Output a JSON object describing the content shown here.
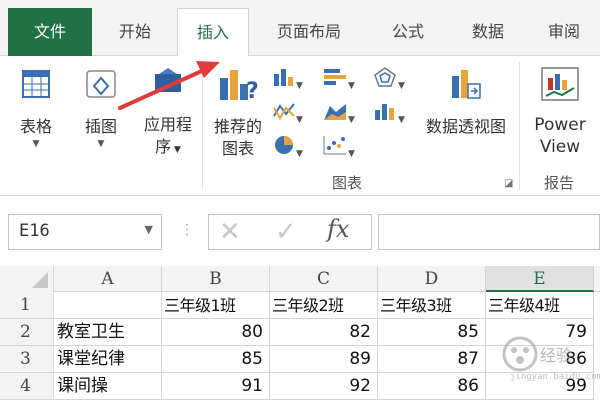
{
  "tabs": [
    {
      "label": "文件"
    },
    {
      "label": "开始"
    },
    {
      "label": "插入"
    },
    {
      "label": "页面布局"
    },
    {
      "label": "公式"
    },
    {
      "label": "数据"
    },
    {
      "label": "审阅"
    }
  ],
  "active_tab": "插入",
  "ribbon": {
    "table_label": "表格",
    "illustrations_label": "插图",
    "apps_label_1": "应用程",
    "apps_label_2": "序",
    "recommended_charts_1": "推荐的",
    "recommended_charts_2": "图表",
    "pivotchart_label": "数据透视图",
    "powerview_1": "Power",
    "powerview_2": "View",
    "group_charts": "图表",
    "group_reports": "报告"
  },
  "formula_bar": {
    "name_box": "E16",
    "fx_label": "fx",
    "formula_value": ""
  },
  "sheet": {
    "columns": [
      "A",
      "B",
      "C",
      "D",
      "E"
    ],
    "selected_column": "E",
    "rows": [
      {
        "num": "1",
        "cells": [
          "",
          "三年级1班",
          "三年级2班",
          "三年级3班",
          "三年级4班"
        ]
      },
      {
        "num": "2",
        "cells": [
          "教室卫生",
          "80",
          "82",
          "85",
          "79"
        ]
      },
      {
        "num": "3",
        "cells": [
          "课堂纪律",
          "85",
          "89",
          "87",
          "86"
        ]
      },
      {
        "num": "4",
        "cells": [
          "课间操",
          "91",
          "92",
          "86",
          "99"
        ]
      }
    ]
  },
  "watermark": {
    "text": "经验",
    "url": "jingyan.baidu.com"
  },
  "colors": {
    "excel_green": "#217346",
    "arrow_red": "#e03a3a"
  }
}
